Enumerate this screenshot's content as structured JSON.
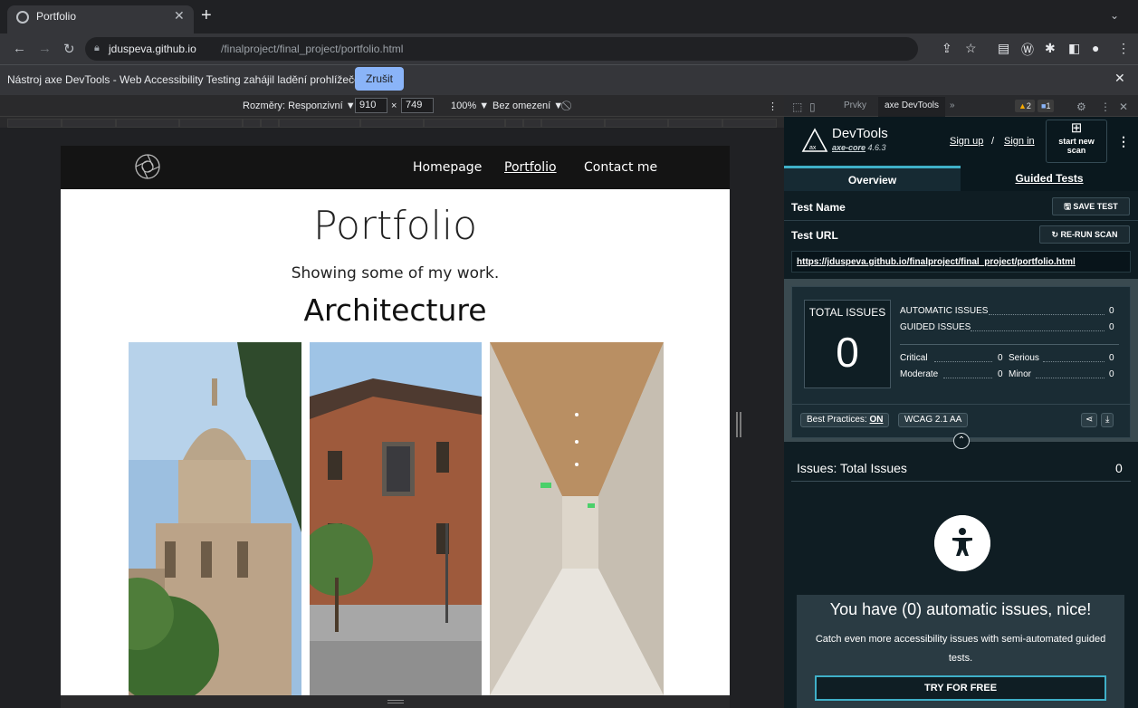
{
  "browser": {
    "tab_title": "Portfolio",
    "url_host": "jduspeva.github.io",
    "url_path": "/finalproject/final_project/portfolio.html"
  },
  "infobar": {
    "message": "Nástroj axe DevTools - Web Accessibility Testing zahájil ladění prohlížeče",
    "cancel": "Zrušit"
  },
  "device_toolbar": {
    "dimensions_label": "Rozměry: Responzivní ▼",
    "width": "910",
    "times": "×",
    "height": "749",
    "zoom": "100% ▼",
    "throttle": "Bez omezení ▼"
  },
  "site": {
    "nav": [
      "Homepage",
      "Portfolio",
      "Contact me"
    ],
    "title": "Portfolio",
    "subtitle": "Showing some of my work.",
    "section": "Architecture"
  },
  "devtools": {
    "tab_elements": "Prvky",
    "tab_axe": "axe DevTools",
    "more": "»",
    "warnings": "2",
    "messages": "1"
  },
  "axe": {
    "name": "DevTools",
    "core": "axe-core",
    "version": "4.6.3",
    "sign_up": "Sign up",
    "slash": "/",
    "sign_in": "Sign in",
    "start_new": "start new",
    "scan": "scan",
    "tab_overview": "Overview",
    "tab_guided": "Guided Tests",
    "test_name_label": "Test Name",
    "save_test": "SAVE TEST",
    "test_url_label": "Test URL",
    "rerun": "RE-RUN SCAN",
    "test_url": "https://jduspeva.github.io/finalproject/final_project/portfolio.html",
    "total_issues_label": "TOTAL ISSUES",
    "total_issues": "0",
    "automatic_label": "AUTOMATIC ISSUES",
    "automatic": "0",
    "guided_label": "GUIDED ISSUES",
    "guided": "0",
    "critical_label": "Critical",
    "critical": "0",
    "serious_label": "Serious",
    "serious": "0",
    "moderate_label": "Moderate",
    "moderate": "0",
    "minor_label": "Minor",
    "minor": "0",
    "best_practices": "Best Practices:",
    "best_practices_state": "ON",
    "wcag": "WCAG 2.1 AA",
    "issues_title": "Issues: Total Issues",
    "issues_count": "0",
    "nice_title": "You have (0) automatic issues, nice!",
    "nice_text": "Catch even more accessibility issues with semi-automated guided tests.",
    "try_free": "TRY FOR FREE"
  }
}
